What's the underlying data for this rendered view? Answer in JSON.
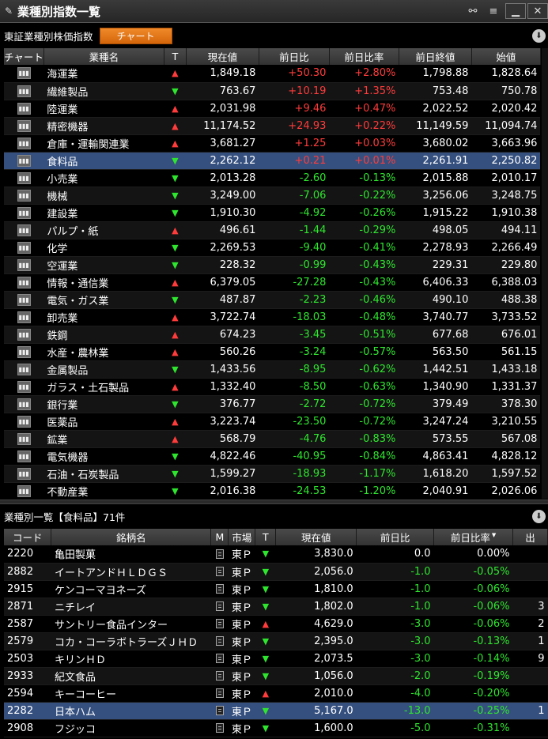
{
  "window": {
    "title": "業種別指数一覧"
  },
  "toolbar": {
    "index_label": "東証業種別株価指数",
    "chart_button": "チャート"
  },
  "sector_table": {
    "headers": [
      "チャート",
      "業種名",
      "T",
      "現在値",
      "前日比",
      "前日比率",
      "前日終値",
      "始値"
    ],
    "chart_icon": "candlestick-chart-icon",
    "rows": [
      {
        "name": "海運業",
        "trend": "up",
        "price": "1,849.18",
        "change": "+50.30",
        "pct": "+2.80%",
        "prev": "1,798.88",
        "open": "1,828.64"
      },
      {
        "name": "繊維製品",
        "trend": "down",
        "price": "763.67",
        "change": "+10.19",
        "pct": "+1.35%",
        "prev": "753.48",
        "open": "750.78"
      },
      {
        "name": "陸運業",
        "trend": "up",
        "price": "2,031.98",
        "change": "+9.46",
        "pct": "+0.47%",
        "prev": "2,022.52",
        "open": "2,020.42"
      },
      {
        "name": "精密機器",
        "trend": "up",
        "price": "11,174.52",
        "change": "+24.93",
        "pct": "+0.22%",
        "prev": "11,149.59",
        "open": "11,094.74"
      },
      {
        "name": "倉庫・運輸関連業",
        "trend": "up",
        "price": "3,681.27",
        "change": "+1.25",
        "pct": "+0.03%",
        "prev": "3,680.02",
        "open": "3,663.96"
      },
      {
        "name": "食料品",
        "trend": "down",
        "price": "2,262.12",
        "change": "+0.21",
        "pct": "+0.01%",
        "prev": "2,261.91",
        "open": "2,250.82",
        "selected": true
      },
      {
        "name": "小売業",
        "trend": "down",
        "price": "2,013.28",
        "change": "-2.60",
        "pct": "-0.13%",
        "prev": "2,015.88",
        "open": "2,010.17"
      },
      {
        "name": "機械",
        "trend": "down",
        "price": "3,249.00",
        "change": "-7.06",
        "pct": "-0.22%",
        "prev": "3,256.06",
        "open": "3,248.75"
      },
      {
        "name": "建設業",
        "trend": "down",
        "price": "1,910.30",
        "change": "-4.92",
        "pct": "-0.26%",
        "prev": "1,915.22",
        "open": "1,910.38"
      },
      {
        "name": "パルプ・紙",
        "trend": "up",
        "price": "496.61",
        "change": "-1.44",
        "pct": "-0.29%",
        "prev": "498.05",
        "open": "494.11"
      },
      {
        "name": "化学",
        "trend": "down",
        "price": "2,269.53",
        "change": "-9.40",
        "pct": "-0.41%",
        "prev": "2,278.93",
        "open": "2,266.49"
      },
      {
        "name": "空運業",
        "trend": "down",
        "price": "228.32",
        "change": "-0.99",
        "pct": "-0.43%",
        "prev": "229.31",
        "open": "229.80"
      },
      {
        "name": "情報・通信業",
        "trend": "up",
        "price": "6,379.05",
        "change": "-27.28",
        "pct": "-0.43%",
        "prev": "6,406.33",
        "open": "6,388.03"
      },
      {
        "name": "電気・ガス業",
        "trend": "down",
        "price": "487.87",
        "change": "-2.23",
        "pct": "-0.46%",
        "prev": "490.10",
        "open": "488.38"
      },
      {
        "name": "卸売業",
        "trend": "up",
        "price": "3,722.74",
        "change": "-18.03",
        "pct": "-0.48%",
        "prev": "3,740.77",
        "open": "3,733.52"
      },
      {
        "name": "鉄鋼",
        "trend": "up",
        "price": "674.23",
        "change": "-3.45",
        "pct": "-0.51%",
        "prev": "677.68",
        "open": "676.01"
      },
      {
        "name": "水産・農林業",
        "trend": "up",
        "price": "560.26",
        "change": "-3.24",
        "pct": "-0.57%",
        "prev": "563.50",
        "open": "561.15"
      },
      {
        "name": "金属製品",
        "trend": "down",
        "price": "1,433.56",
        "change": "-8.95",
        "pct": "-0.62%",
        "prev": "1,442.51",
        "open": "1,433.18"
      },
      {
        "name": "ガラス・土石製品",
        "trend": "up",
        "price": "1,332.40",
        "change": "-8.50",
        "pct": "-0.63%",
        "prev": "1,340.90",
        "open": "1,331.37"
      },
      {
        "name": "銀行業",
        "trend": "down",
        "price": "376.77",
        "change": "-2.72",
        "pct": "-0.72%",
        "prev": "379.49",
        "open": "378.30"
      },
      {
        "name": "医薬品",
        "trend": "up",
        "price": "3,223.74",
        "change": "-23.50",
        "pct": "-0.72%",
        "prev": "3,247.24",
        "open": "3,210.55"
      },
      {
        "name": "鉱業",
        "trend": "up",
        "price": "568.79",
        "change": "-4.76",
        "pct": "-0.83%",
        "prev": "573.55",
        "open": "567.08"
      },
      {
        "name": "電気機器",
        "trend": "down",
        "price": "4,822.46",
        "change": "-40.95",
        "pct": "-0.84%",
        "prev": "4,863.41",
        "open": "4,828.12"
      },
      {
        "name": "石油・石炭製品",
        "trend": "down",
        "price": "1,599.27",
        "change": "-18.93",
        "pct": "-1.17%",
        "prev": "1,618.20",
        "open": "1,597.52"
      },
      {
        "name": "不動産業",
        "trend": "down",
        "price": "2,016.38",
        "change": "-24.53",
        "pct": "-1.20%",
        "prev": "2,040.91",
        "open": "2,026.06"
      }
    ]
  },
  "stock_list": {
    "label": "業種別一覧【食料品】71件",
    "headers": [
      "コード",
      "銘柄名",
      "M",
      "市場",
      "T",
      "現在値",
      "前日比",
      "前日比率",
      "出"
    ],
    "rows": [
      {
        "code": "2220",
        "name": "亀田製菓",
        "market": "東Ｐ",
        "trend": "down",
        "price": "3,830.0",
        "change": "0.0",
        "pct": "0.00%",
        "extra": ""
      },
      {
        "code": "2882",
        "name": "イートアンドＨＬＤＧＳ",
        "market": "東Ｐ",
        "trend": "down",
        "price": "2,056.0",
        "change": "-1.0",
        "pct": "-0.05%",
        "extra": ""
      },
      {
        "code": "2915",
        "name": "ケンコーマヨネーズ",
        "market": "東Ｐ",
        "trend": "down",
        "price": "1,810.0",
        "change": "-1.0",
        "pct": "-0.06%",
        "extra": ""
      },
      {
        "code": "2871",
        "name": "ニチレイ",
        "market": "東Ｐ",
        "trend": "down",
        "price": "1,802.0",
        "change": "-1.0",
        "pct": "-0.06%",
        "extra": "3"
      },
      {
        "code": "2587",
        "name": "サントリー食品インター",
        "market": "東Ｐ",
        "trend": "up",
        "price": "4,629.0",
        "change": "-3.0",
        "pct": "-0.06%",
        "extra": "2"
      },
      {
        "code": "2579",
        "name": "コカ・コーラボトラーズＪＨＤ",
        "market": "東Ｐ",
        "trend": "down",
        "price": "2,395.0",
        "change": "-3.0",
        "pct": "-0.13%",
        "extra": "1"
      },
      {
        "code": "2503",
        "name": "キリンＨＤ",
        "market": "東Ｐ",
        "trend": "down",
        "price": "2,073.5",
        "change": "-3.0",
        "pct": "-0.14%",
        "extra": "9"
      },
      {
        "code": "2933",
        "name": "紀文食品",
        "market": "東Ｐ",
        "trend": "down",
        "price": "1,056.0",
        "change": "-2.0",
        "pct": "-0.19%",
        "extra": ""
      },
      {
        "code": "2594",
        "name": "キーコーヒー",
        "market": "東Ｐ",
        "trend": "up",
        "price": "2,010.0",
        "change": "-4.0",
        "pct": "-0.20%",
        "extra": ""
      },
      {
        "code": "2282",
        "name": "日本ハム",
        "market": "東Ｐ",
        "trend": "down",
        "price": "5,167.0",
        "change": "-13.0",
        "pct": "-0.25%",
        "extra": "1",
        "selected": true
      },
      {
        "code": "2908",
        "name": "フジッコ",
        "market": "東Ｐ",
        "trend": "down",
        "price": "1,600.0",
        "change": "-5.0",
        "pct": "-0.31%",
        "extra": ""
      }
    ]
  },
  "colors": {
    "up": "#ff3b3b",
    "down": "#2ee62e",
    "selected_row": "#35507f",
    "accent_button": "#e57a1c"
  }
}
